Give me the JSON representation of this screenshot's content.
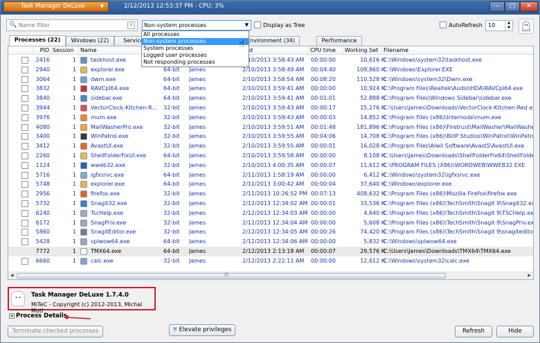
{
  "titlebar": {
    "app_name": "Task Manager DeLuxe",
    "status": "2/12/2013 12:53:37 PM - CPU: 3%",
    "minimize": "‒",
    "maximize": "□",
    "close": "✕"
  },
  "toolbar": {
    "filter_placeholder": "Name filter",
    "filter_value": "",
    "combo_value": "Non-system processes",
    "display_tree_label": "Display as Tree",
    "autorefresh_label": "AutoRefresh",
    "autorefresh_value": "10"
  },
  "dropdown": {
    "options": [
      "All processes",
      "Non-system processes",
      "System processes",
      "Logged user processes",
      "Not responding processes"
    ],
    "selected": "Non-system processes"
  },
  "tabs": [
    "Processes (22)",
    "Windows (22)",
    "Services",
    "Environment (34)",
    "Performance"
  ],
  "columns": {
    "pid": "PID",
    "session": "Session",
    "name": "Name",
    "start": "ted",
    "cpu": "CPU time",
    "ws": "Working Set",
    "file": "Filename"
  },
  "processes": [
    {
      "pid": "2416",
      "session": "1",
      "name": "taskhost.exe",
      "arch": "64-bit",
      "user": "James",
      "start": "2/10/2013 3:58:43 AM",
      "cpu": "00:00:00",
      "ws": "10,616 K",
      "file": "C:\\Windows\\system32\\taskhost.exe",
      "icon_color": "#6f8fb8"
    },
    {
      "pid": "2940",
      "session": "1",
      "name": "explorer.exe",
      "arch": "64-bit",
      "user": "James",
      "start": "2/10/2013 3:58:49 AM",
      "cpu": "00:04:40",
      "ws": "109,860 K",
      "file": "C:\\Windows\\Explorer.EXE",
      "icon_color": "#e5b84b"
    },
    {
      "pid": "3064",
      "session": "1",
      "name": "dwm.exe",
      "arch": "64-bit",
      "user": "James",
      "start": "2/10/2013 3:58:54 AM",
      "cpu": "00:08:20",
      "ws": "110,528 K",
      "file": "C:\\Windows\\system32\\Dwm.exe",
      "icon_color": "#7a9fcc"
    },
    {
      "pid": "3832",
      "session": "1",
      "name": "RAVCpl64.exe",
      "arch": "64-bit",
      "user": "James",
      "start": "2/10/2013 3:59:41 AM",
      "cpu": "00:00:00",
      "ws": "10,924 K",
      "file": "C:\\Program Files\\Realtek\\Audio\\HDA\\RAVCpl64.exe",
      "icon_color": "#c9372c"
    },
    {
      "pid": "3840",
      "session": "1",
      "name": "sidebar.exe",
      "arch": "64-bit",
      "user": "James",
      "start": "2/10/2013 3:59:41 AM",
      "cpu": "00:01:01",
      "ws": "52,888 K",
      "file": "C:\\Program Files\\Windows Sidebar\\sidebar.exe",
      "icon_color": "#4f86c6"
    },
    {
      "pid": "3944",
      "session": "1",
      "name": "VectorClock-Kitchen-R...",
      "arch": "32-bit",
      "user": "James",
      "start": "2/10/2013 3:59:43 AM",
      "cpu": "00:00:17",
      "ws": "15,276 K",
      "file": "C:\\Users\\James\\Downloads\\VectorClock-Kitchen-Red.exe",
      "icon_color": "#d9534f"
    },
    {
      "pid": "3976",
      "session": "1",
      "name": "mum.exe",
      "arch": "32-bit",
      "user": "James",
      "start": "2/10/2013 3:59:43 AM",
      "cpu": "00:00:03",
      "ws": "14,852 K",
      "file": "C:\\Program Files (x86)\\Internode\\mum.exe",
      "icon_color": "#e8892b"
    },
    {
      "pid": "4080",
      "session": "1",
      "name": "MailWasherPro.exe",
      "arch": "32-bit",
      "user": "James",
      "start": "2/10/2013 3:59:51 AM",
      "cpu": "00:01:48",
      "ws": "181,896 K",
      "file": "C:\\Program Files (x86)\\Firetrust\\MailWasher\\MailWasherPro",
      "icon_color": "#f0a830"
    },
    {
      "pid": "3400",
      "session": "1",
      "name": "WinPatrol.exe",
      "arch": "32-bit",
      "user": "James",
      "start": "2/10/2013 3:59:55 AM",
      "cpu": "00:04:06",
      "ws": "14,708 K",
      "file": "C:\\Program Files (x86)\\BillP Studios\\WinPatrol\\WinPatrol.ex",
      "icon_color": "#3a3a3a"
    },
    {
      "pid": "3412",
      "session": "1",
      "name": "AvastUI.exe",
      "arch": "32-bit",
      "user": "James",
      "start": "2/10/2013 3:59:55 AM",
      "cpu": "00:00:01",
      "ws": "16,028 K",
      "file": "C:\\Program Files\\Alwil Software\\Avast5\\AvastUI.exe",
      "icon_color": "#e86a1c"
    },
    {
      "pid": "2260",
      "session": "1",
      "name": "ShellFolderFixUI.exe",
      "arch": "64-bit",
      "user": "James",
      "start": "2/10/2013 3:59:58 AM",
      "cpu": "00:00:00",
      "ws": "8,108 K",
      "file": "C:\\Users\\James\\Downloads\\ShellFolderFix64\\ShellFolderFix",
      "icon_color": "#e6c04a"
    },
    {
      "pid": "1124",
      "session": "1",
      "name": "wweb32.exe",
      "arch": "32-bit",
      "user": "James",
      "start": "2/10/2013 4:00:35 AM",
      "cpu": "00:00:07",
      "ws": "11,612 K",
      "file": "C:\\PROGRAM FILES (X86)\\WORDWEB\\WWEB32.EXE",
      "icon_color": "#2f5fa8"
    },
    {
      "pid": "5716",
      "session": "1",
      "name": "igfxsrvc.exe",
      "arch": "64-bit",
      "user": "James",
      "start": "2/11/2013 1:58:19 AM",
      "cpu": "00:00:00",
      "ws": "6,412 K",
      "file": "C:\\Windows\\system32\\igfxsrvc.exe",
      "icon_color": "#8fa6c4"
    },
    {
      "pid": "5748",
      "session": "1",
      "name": "explorer.exe",
      "arch": "64-bit",
      "user": "James",
      "start": "2/11/2013 3:00:42 AM",
      "cpu": "00:00:04",
      "ws": "37,640 K",
      "file": "C:\\Windows\\explorer.exe",
      "icon_color": "#e5b84b"
    },
    {
      "pid": "2956",
      "session": "1",
      "name": "firefox.exe",
      "arch": "32-bit",
      "user": "James",
      "start": "2/11/2013 10:26:52 PM",
      "cpu": "00:07:13",
      "ws": "408,632 K",
      "file": "C:\\Program Files (x86)\\Mozilla Firefox\\firefox.exe",
      "icon_color": "#e2661d"
    },
    {
      "pid": "5732",
      "session": "1",
      "name": "Snagit32.exe",
      "arch": "32-bit",
      "user": "James",
      "start": "2/12/2013 12:34:02 AM",
      "cpu": "00:00:01",
      "ws": "33,536 K",
      "file": "C:\\Program Files (x86)\\TechSmith\\Snagit 9\\Snagit32.exe",
      "icon_color": "#3e7fc4"
    },
    {
      "pid": "6240",
      "session": "1",
      "name": "TscHelp.exe",
      "arch": "32-bit",
      "user": "James",
      "start": "2/12/2013 12:34:03 AM",
      "cpu": "00:00:00",
      "ws": "4,640 K",
      "file": "C:\\Program Files (x86)\\TechSmith\\Snagit 9\\TSCHelp.exe",
      "icon_color": "#9aa9bb"
    },
    {
      "pid": "6172",
      "session": "1",
      "name": "SnagPriv.exe",
      "arch": "32-bit",
      "user": "James",
      "start": "2/12/2013 12:34:04 AM",
      "cpu": "00:00:00",
      "ws": "5,608 K",
      "file": "C:\\Program Files (x86)\\TechSmith\\Snagit 9\\SnagPriv.exe",
      "icon_color": "#9aa9bb"
    },
    {
      "pid": "5860",
      "session": "1",
      "name": "SnagitEditor.exe",
      "arch": "32-bit",
      "user": "James",
      "start": "2/12/2013 12:34:05 AM",
      "cpu": "00:00:26",
      "ws": "74,420 K",
      "file": "C:\\Program Files (x86)\\TechSmith\\Snagit 9\\snagiteditor.exe",
      "icon_color": "#6f8090"
    },
    {
      "pid": "5428",
      "session": "1",
      "name": "splwow64.exe",
      "arch": "64-bit",
      "user": "James",
      "start": "2/12/2013 12:34:06 AM",
      "cpu": "00:00:00",
      "ws": "5,832 K",
      "file": "C:\\Windows\\splwow64.exe",
      "icon_color": "#9aa9bb"
    },
    {
      "pid": "7772",
      "session": "1",
      "name": "TMX64.exe",
      "arch": "64-bit",
      "user": "James",
      "start": "2/12/2013 2:13:18 AM",
      "cpu": "00:00:07",
      "ws": "29,576 K",
      "file": "C:\\Users\\James\\Downloads\\TMX64\\TMX64.exe",
      "icon_color": "#ffffff",
      "self": true
    },
    {
      "pid": "6660",
      "session": "1",
      "name": "calc.exe",
      "arch": "32-bit",
      "user": "James",
      "start": "2/12/2013 2:22:11 AM",
      "cpu": "00:00:00",
      "ws": "12,612 K",
      "file": "C:\\Windows\\system32\\calc.exe",
      "icon_color": "#7ea3cf"
    }
  ],
  "info": {
    "product": "Task Manager DeLuxe 1.7.4.0",
    "copyright": "MiTeC - Copyright (c) 2012-2013, Michal Mutl"
  },
  "details_label": "Process Details",
  "buttons": {
    "terminate": "Terminate checked processes",
    "elevate": "Elevate privileges",
    "refresh": "Refresh",
    "hide": "Hide"
  },
  "colors": {
    "titlebar": "#2c5593",
    "app_button": "#e8871e",
    "user_process_text": "#1634a6",
    "selected_option": "#3399ff",
    "highlight_border": "#c8202a"
  }
}
